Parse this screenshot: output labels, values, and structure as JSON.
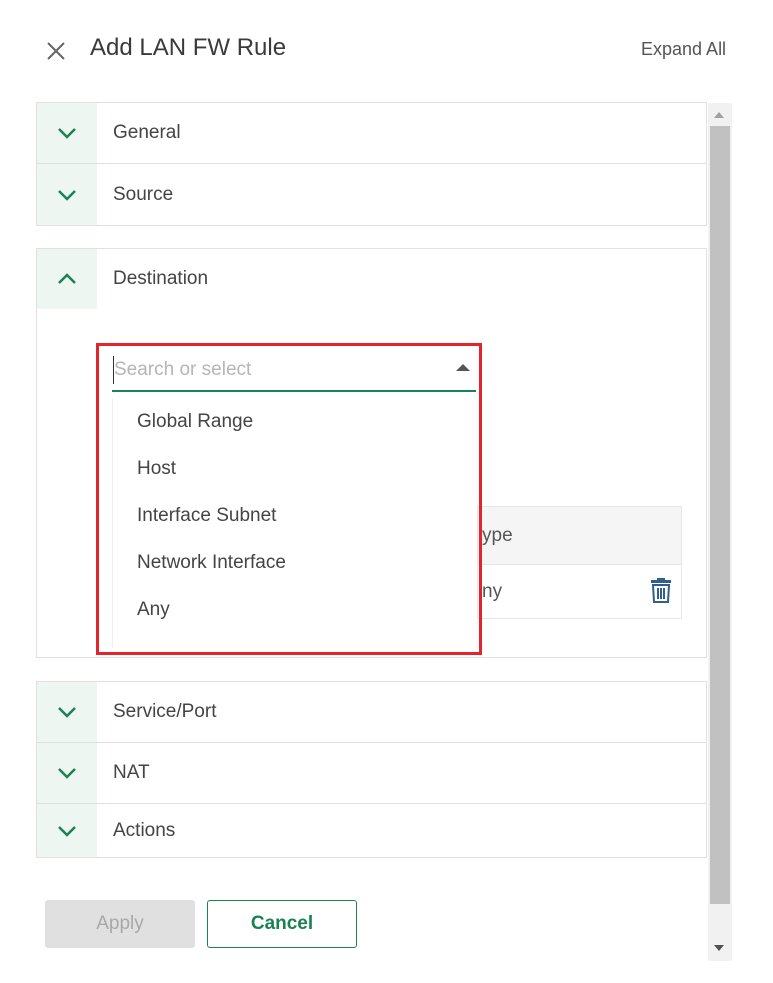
{
  "header": {
    "title": "Add LAN FW Rule",
    "expand_all": "Expand All"
  },
  "sections_top": [
    {
      "label": "General",
      "state": "collapsed"
    },
    {
      "label": "Source",
      "state": "collapsed"
    }
  ],
  "destination": {
    "label": "Destination",
    "state": "expanded",
    "search": {
      "placeholder": "Search or select",
      "value": ""
    },
    "options": [
      "Global Range",
      "Host",
      "Interface Subnet",
      "Network Interface",
      "Any"
    ],
    "table": {
      "type_header": "ype",
      "type_value": "ny"
    }
  },
  "sections_bottom": [
    {
      "label": "Service/Port",
      "state": "collapsed"
    },
    {
      "label": "NAT",
      "state": "collapsed"
    },
    {
      "label": "Actions",
      "state": "collapsed"
    }
  ],
  "buttons": {
    "apply": "Apply",
    "cancel": "Cancel"
  },
  "colors": {
    "accent": "#1a8254",
    "highlight_frame": "#e3242b",
    "chevron_bg": "#eef6f2"
  },
  "icons": {
    "close": "close-icon",
    "chevron_down": "chevron-down-icon",
    "chevron_up": "chevron-up-icon",
    "trash": "trash-icon",
    "caret_up": "caret-up-icon"
  }
}
